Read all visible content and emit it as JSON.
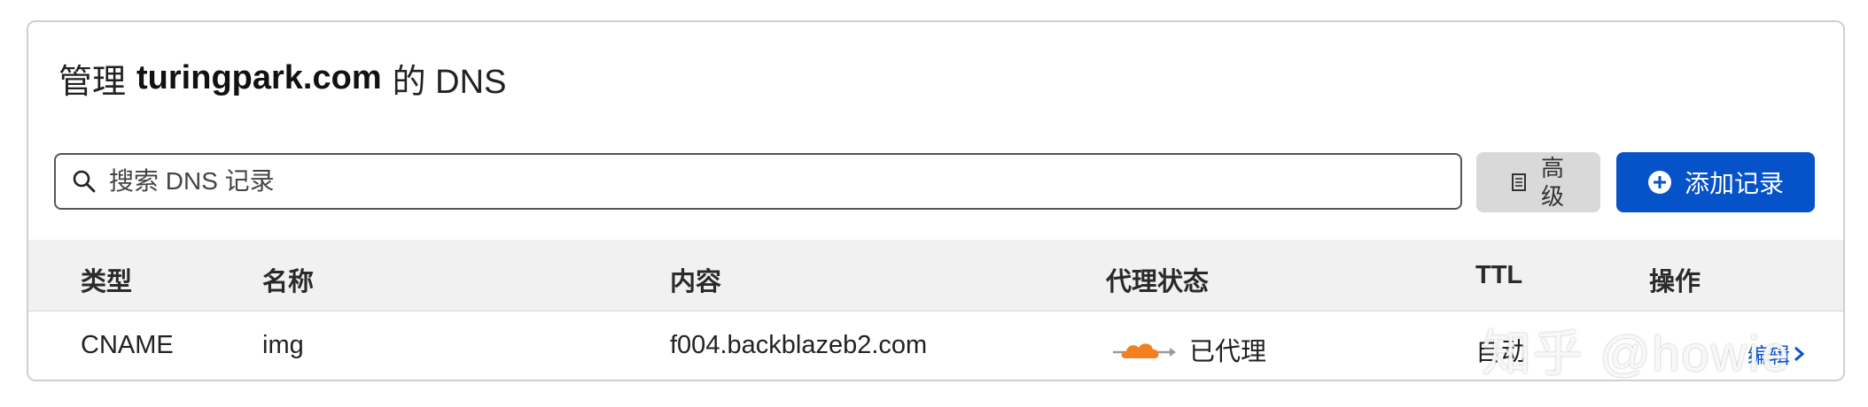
{
  "header": {
    "title_prefix": "管理",
    "domain": "turingpark.com",
    "title_suffix": "的 DNS"
  },
  "search": {
    "placeholder": "搜索 DNS 记录"
  },
  "toolbar": {
    "advanced_label": "高级",
    "add_record_label": "添加记录"
  },
  "table": {
    "columns": [
      "类型",
      "名称",
      "内容",
      "代理状态",
      "TTL",
      "操作"
    ],
    "rows": [
      {
        "type": "CNAME",
        "name": "img",
        "content": "f004.backblazeb2.com",
        "proxy_status": "已代理",
        "ttl": "自动",
        "action": "编辑"
      }
    ]
  },
  "watermark": "知乎 @howie",
  "colors": {
    "primary": "#0552c9",
    "proxy_orange": "#f38020"
  }
}
